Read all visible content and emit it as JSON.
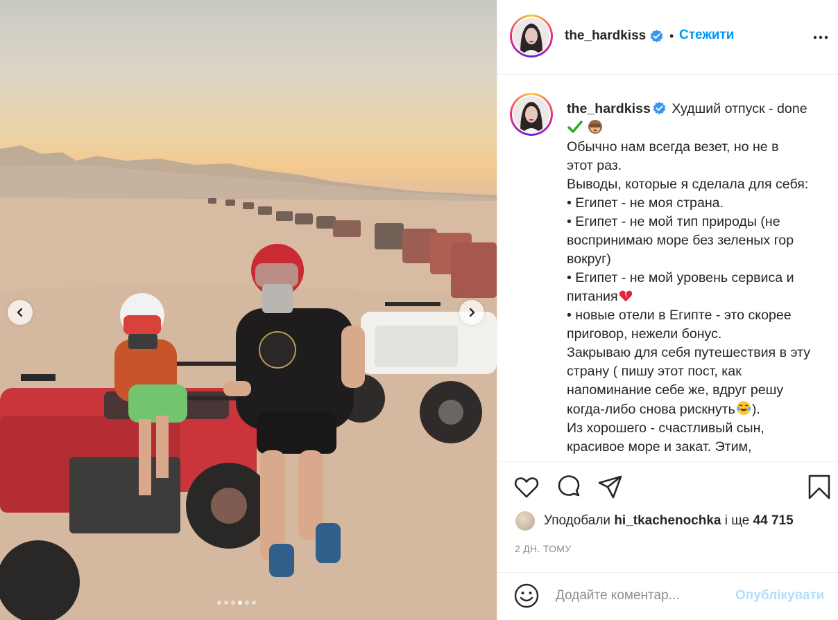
{
  "post": {
    "username": "the_hardkiss",
    "follow_label": "Стежити",
    "separator": "•"
  },
  "caption": {
    "username": "the_hardkiss",
    "lines": [
      "Худший отпуск - done",
      "Обычно нам всегда везет, но не в",
      "этот раз.",
      "Выводы, которые я сделала для себя:",
      "• Египет - не моя страна.",
      "• Египет - не мой тип природы (не",
      "воспринимаю море без зеленых гор",
      "вокруг)",
      "• Египет - не мой уровень сервиса и",
      "питания",
      "• новые отели в Египте - это скорее",
      "приговор, нежели бонус.",
      "Закрываю для себя путешествия в эту",
      "страну ( пишу этот пост, как",
      "напоминание себе же, вдруг решу",
      "когда-либо снова рискнуть",
      ").",
      "Из хорошего - счастливый сын,",
      "красивое море и закат. Этим,"
    ]
  },
  "likes": {
    "prefix": "Уподобали",
    "user": "hi_tkachenochka",
    "middle": "і ще",
    "count": "44 715"
  },
  "timestamp": "2 ДН. ТОМУ",
  "comment_form": {
    "placeholder": "Додайте коментар...",
    "publish_label": "Опублікувати"
  },
  "carousel": {
    "total": 6,
    "active_index": 3
  },
  "icons": {
    "verified": "verified-badge-icon",
    "more": "more-options-icon",
    "like": "heart-icon",
    "comment": "comment-icon",
    "share": "paper-plane-icon",
    "save": "bookmark-icon",
    "emoji": "smiley-icon",
    "prev": "chevron-left-icon",
    "next": "chevron-right-icon"
  },
  "colors": {
    "accent": "#0095f6",
    "publish_disabled": "#b2dffc",
    "secondary_text": "#8e8e8e",
    "verified": "#3897f0"
  }
}
